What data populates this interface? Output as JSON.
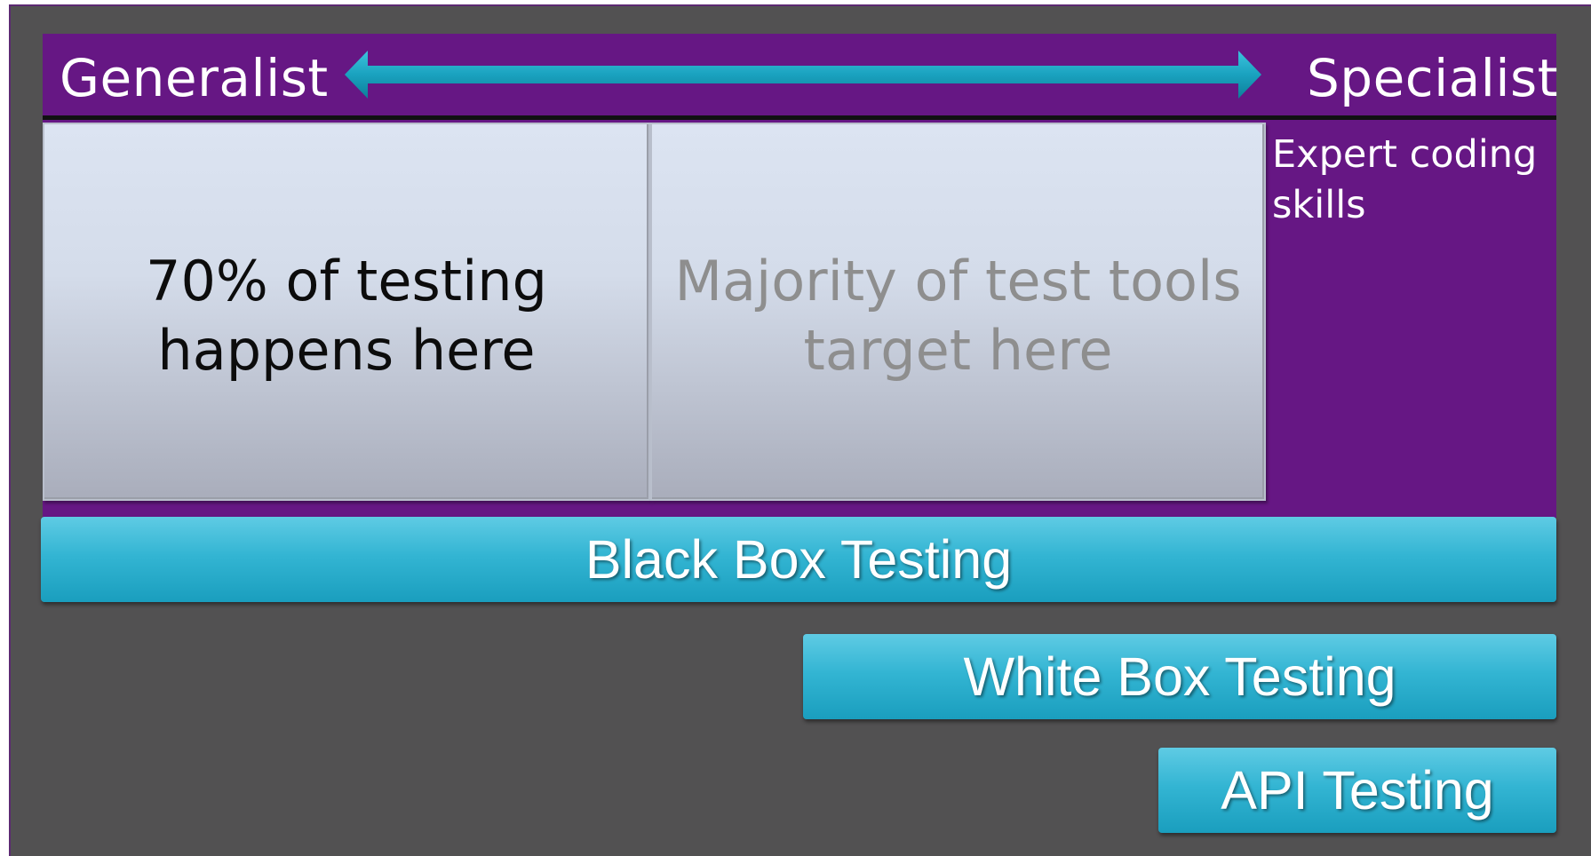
{
  "header": {
    "left_label": "Generalist",
    "right_label": "Specialist"
  },
  "expert_note": "Expert coding skills",
  "boxes": [
    {
      "text": "70% of testing happens here"
    },
    {
      "text": "Majority of test tools target here"
    }
  ],
  "bars": [
    {
      "label": "Black Box Testing"
    },
    {
      "label": "White Box Testing"
    },
    {
      "label": "API Testing"
    }
  ],
  "colors": {
    "background": "#525152",
    "panel": "#661784",
    "bar": "#33b5d3",
    "box": "#d4dcea",
    "arrow": "#1aa2bf"
  },
  "icons": {
    "arrow": "double-headed-arrow-icon"
  }
}
